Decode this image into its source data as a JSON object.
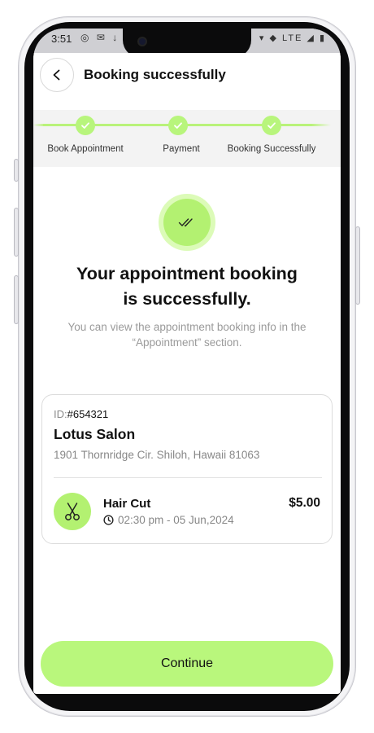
{
  "status_bar": {
    "time": "3:51",
    "left_icons": "◎ ✉ ↓",
    "right_icons": "▾ ◆ LTE ◢ ▮"
  },
  "header": {
    "title": "Booking successfully"
  },
  "stepper": {
    "steps": [
      {
        "label": "Book Appointment",
        "done": true
      },
      {
        "label": "Payment",
        "done": true
      },
      {
        "label": "Booking Successfully",
        "done": true
      }
    ],
    "accent": "#b8f57c"
  },
  "success": {
    "headline_line1": "Your appointment booking",
    "headline_line2": "is successfully.",
    "subtext": "You can view the appointment booking info in the “Appointment” section."
  },
  "booking": {
    "id_label": "ID:",
    "id_value": "#654321",
    "salon_name": "Lotus Salon",
    "address": "1901 Thornridge Cir. Shiloh, Hawaii 81063",
    "service": {
      "name": "Hair Cut",
      "time": "02:30 pm - 05 Jun,2024",
      "price": "$5.00"
    }
  },
  "actions": {
    "continue_label": "Continue"
  },
  "colors": {
    "accent": "#b3f171",
    "accent_light": "#dcfbb8",
    "button": "#b9f77c"
  }
}
